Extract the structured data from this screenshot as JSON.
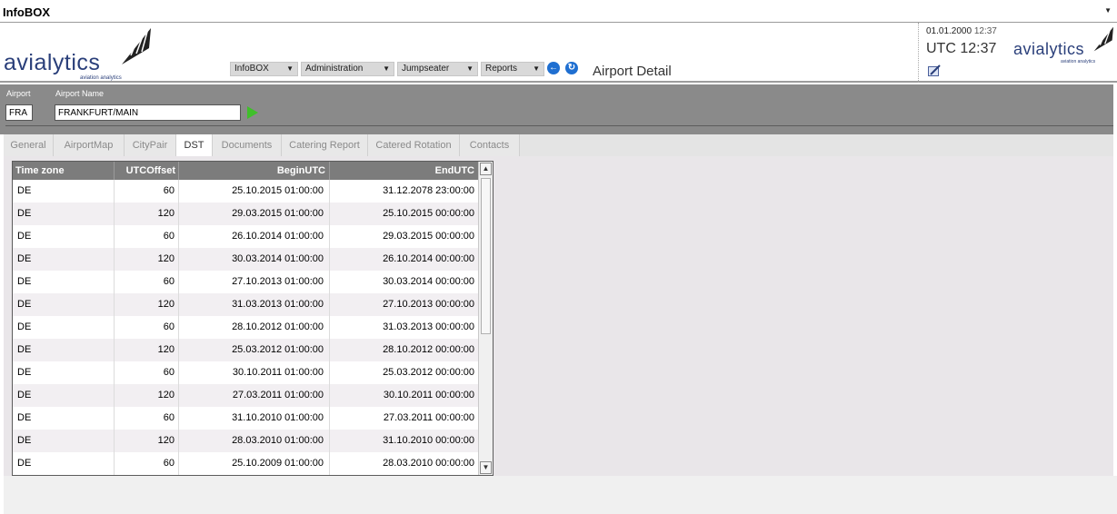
{
  "app": {
    "title": "InfoBOX"
  },
  "header": {
    "logo_text": "avialytics",
    "logo_sub": "aviation analytics",
    "menus": [
      {
        "label": "InfoBOX"
      },
      {
        "label": "Administration"
      },
      {
        "label": "Jumpseater"
      },
      {
        "label": "Reports"
      }
    ],
    "page_title": "Airport Detail",
    "date": "01.01.2000",
    "time": "12:37",
    "utc_clock": "UTC 12:37"
  },
  "search": {
    "airport_label": "Airport",
    "airport_value": "FRA",
    "airport_name_label": "Airport Name",
    "airport_name_value": "FRANKFURT/MAIN"
  },
  "tabs": [
    {
      "label": "General"
    },
    {
      "label": "AirportMap"
    },
    {
      "label": "CityPair"
    },
    {
      "label": "DST"
    },
    {
      "label": "Documents"
    },
    {
      "label": "Catering Report"
    },
    {
      "label": "Catered Rotation"
    },
    {
      "label": "Contacts"
    }
  ],
  "active_tab": "DST",
  "grid": {
    "columns": [
      "Time zone",
      "UTCOffset",
      "BeginUTC",
      "EndUTC"
    ],
    "rows": [
      [
        "DE",
        "60",
        "25.10.2015 01:00:00",
        "31.12.2078 23:00:00"
      ],
      [
        "DE",
        "120",
        "29.03.2015 01:00:00",
        "25.10.2015 00:00:00"
      ],
      [
        "DE",
        "60",
        "26.10.2014 01:00:00",
        "29.03.2015 00:00:00"
      ],
      [
        "DE",
        "120",
        "30.03.2014 01:00:00",
        "26.10.2014 00:00:00"
      ],
      [
        "DE",
        "60",
        "27.10.2013 01:00:00",
        "30.03.2014 00:00:00"
      ],
      [
        "DE",
        "120",
        "31.03.2013 01:00:00",
        "27.10.2013 00:00:00"
      ],
      [
        "DE",
        "60",
        "28.10.2012 01:00:00",
        "31.03.2013 00:00:00"
      ],
      [
        "DE",
        "120",
        "25.03.2012 01:00:00",
        "28.10.2012 00:00:00"
      ],
      [
        "DE",
        "60",
        "30.10.2011 01:00:00",
        "25.03.2012 00:00:00"
      ],
      [
        "DE",
        "120",
        "27.03.2011 01:00:00",
        "30.10.2011 00:00:00"
      ],
      [
        "DE",
        "60",
        "31.10.2010 01:00:00",
        "27.03.2011 00:00:00"
      ],
      [
        "DE",
        "120",
        "28.03.2010 01:00:00",
        "31.10.2010 00:00:00"
      ],
      [
        "DE",
        "60",
        "25.10.2009 01:00:00",
        "28.03.2010 00:00:00"
      ]
    ]
  },
  "icons": {
    "collapse": "collapse-arrow-icon",
    "back": "back-arrow-icon",
    "refresh": "refresh-icon",
    "go": "go-arrow-icon",
    "edit": "edit-icon"
  },
  "colors": {
    "brand": "#2a3f7a",
    "header_gray": "#8a8a8a",
    "grid_header": "#7c7c7c",
    "go_green": "#3fbf2a",
    "nav_blue": "#1f6fd1"
  }
}
